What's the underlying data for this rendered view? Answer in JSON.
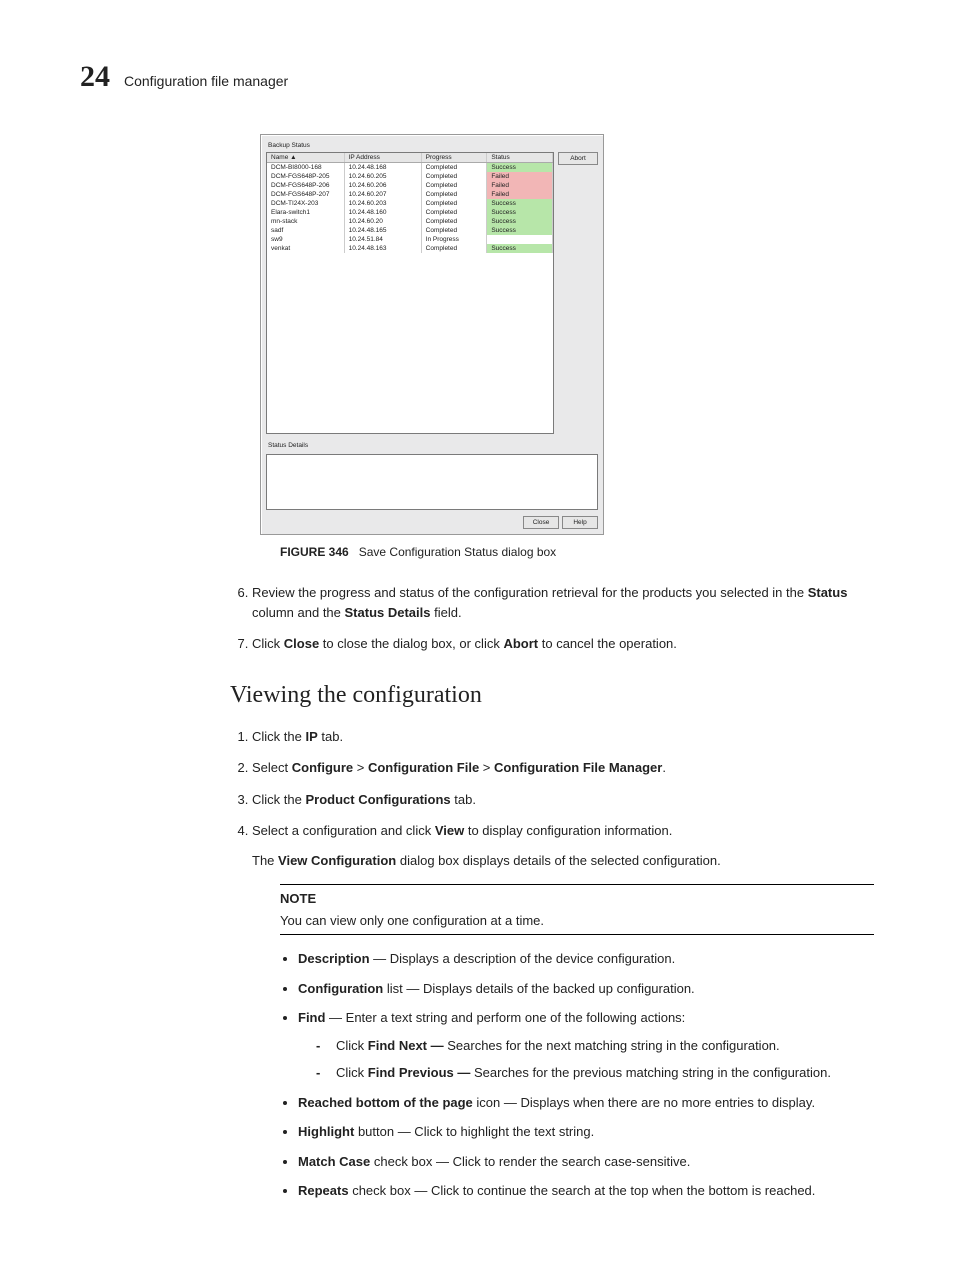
{
  "header": {
    "page_number": "24",
    "section": "Configuration file manager"
  },
  "dialog": {
    "backup_status_label": "Backup Status",
    "columns": {
      "name": "Name ▲",
      "ip": "IP Address",
      "progress": "Progress",
      "status": "Status"
    },
    "rows": [
      {
        "name": "DCM-BI8000-168",
        "ip": "10.24.48.168",
        "progress": "Completed",
        "status": "Success",
        "cls": "cell-success"
      },
      {
        "name": "DCM-FGS648P-205",
        "ip": "10.24.60.205",
        "progress": "Completed",
        "status": "Failed",
        "cls": "cell-failed"
      },
      {
        "name": "DCM-FGS648P-206",
        "ip": "10.24.60.206",
        "progress": "Completed",
        "status": "Failed",
        "cls": "cell-failed"
      },
      {
        "name": "DCM-FGS648P-207",
        "ip": "10.24.60.207",
        "progress": "Completed",
        "status": "Failed",
        "cls": "cell-failed"
      },
      {
        "name": "DCM-TI24X-203",
        "ip": "10.24.60.203",
        "progress": "Completed",
        "status": "Success",
        "cls": "cell-success"
      },
      {
        "name": "Elara-switch1",
        "ip": "10.24.48.160",
        "progress": "Completed",
        "status": "Success",
        "cls": "cell-success"
      },
      {
        "name": "mn-stack",
        "ip": "10.24.60.20",
        "progress": "Completed",
        "status": "Success",
        "cls": "cell-success"
      },
      {
        "name": "sadf",
        "ip": "10.24.48.165",
        "progress": "Completed",
        "status": "Success",
        "cls": "cell-success"
      },
      {
        "name": "sw9",
        "ip": "10.24.51.84",
        "progress": "In Progress",
        "status": "",
        "cls": ""
      },
      {
        "name": "venkat",
        "ip": "10.24.48.163",
        "progress": "Completed",
        "status": "Success",
        "cls": "cell-success"
      }
    ],
    "abort_label": "Abort",
    "status_details_label": "Status Details",
    "close_label": "Close",
    "help_label": "Help"
  },
  "figure": {
    "label": "FIGURE 346",
    "caption": "Save Configuration Status dialog box"
  },
  "steps_a": {
    "s6": {
      "pre": "Review the progress and status of the configuration retrieval for the products you selected in the ",
      "b1": "Status",
      "mid": " column and the ",
      "b2": "Status Details",
      "post": " field."
    },
    "s7": {
      "pre": "Click ",
      "b1": "Close",
      "mid": " to close the dialog box, or click ",
      "b2": "Abort",
      "post": " to cancel the operation."
    }
  },
  "h2": "Viewing the configuration",
  "steps_b": {
    "s1": {
      "pre": "Click the ",
      "b1": "IP",
      "post": " tab."
    },
    "s2": {
      "pre": "Select ",
      "b1": "Configure",
      "sep1": " > ",
      "b2": "Configuration File",
      "sep2": " > ",
      "b3": "Configuration File Manager",
      "post": "."
    },
    "s3": {
      "pre": "Click the ",
      "b1": "Product Configurations",
      "post": " tab."
    },
    "s4": {
      "pre": "Select a configuration and click ",
      "b1": "View",
      "post": " to display configuration information."
    },
    "s4b": {
      "pre": "The ",
      "b1": "View Configuration",
      "post": " dialog box displays details of the selected configuration."
    }
  },
  "note": {
    "label": "NOTE",
    "text": "You can view only one configuration at a time."
  },
  "bullets": {
    "b1": {
      "b": "Description",
      "t": " — Displays a description of the device configuration."
    },
    "b2": {
      "b": "Configuration",
      "t": " list — Displays details of the backed up configuration."
    },
    "b3": {
      "b": "Find",
      "t": " — Enter a text string and perform one of the following actions:"
    },
    "b3a": {
      "pre": "Click ",
      "b": "Find Next — ",
      "t": "Searches for the next matching string in the configuration."
    },
    "b3b": {
      "pre": "Click ",
      "b": "Find Previous — ",
      "t": "Searches for the previous matching string in the configuration."
    },
    "b4": {
      "b": "Reached bottom of the page",
      "t": " icon — Displays when there are no more entries to display."
    },
    "b5": {
      "b": "Highlight",
      "t": " button — Click to highlight the text string."
    },
    "b6": {
      "b": "Match Case",
      "t": " check box — Click to render the search case-sensitive."
    },
    "b7": {
      "b": "Repeats",
      "t": " check box — Click to continue the search at the top when the bottom is reached."
    }
  }
}
